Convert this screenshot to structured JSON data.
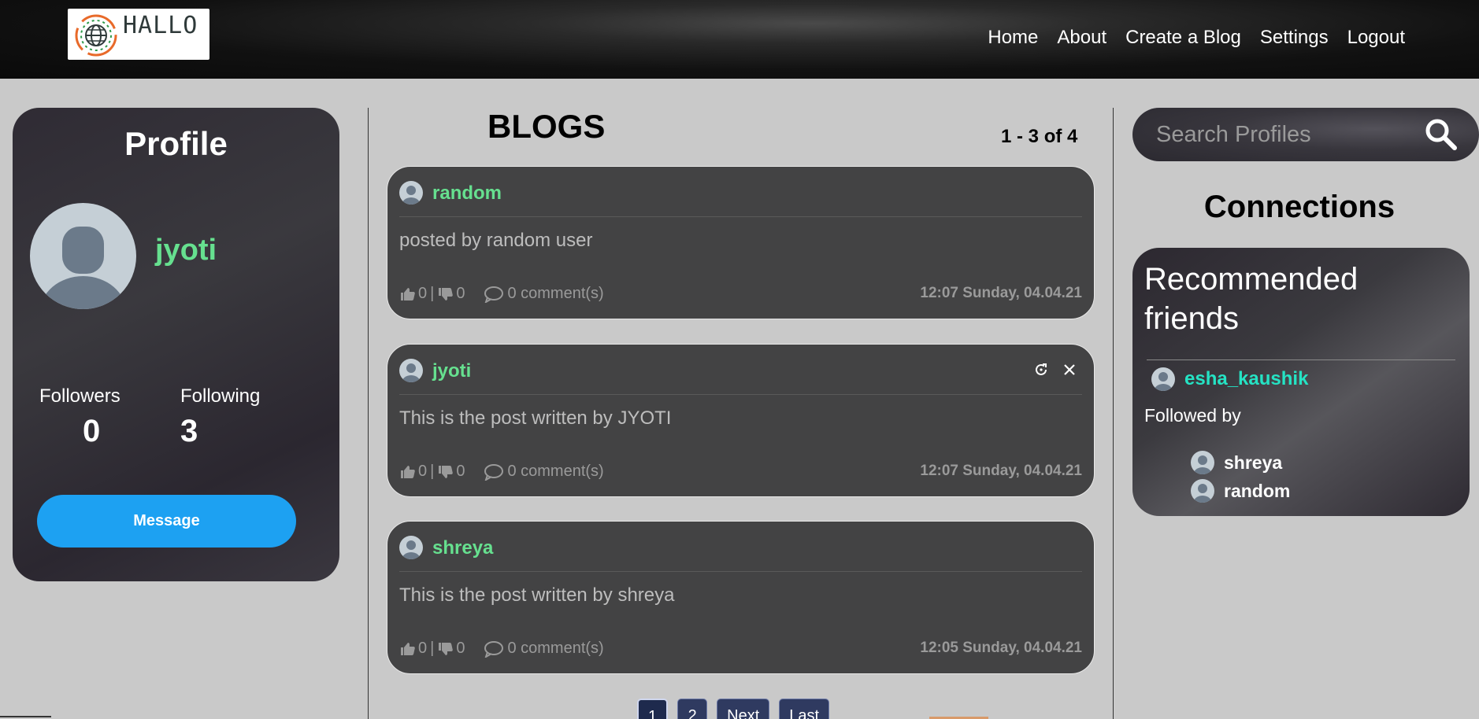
{
  "brand": {
    "logo_text": "HALLO"
  },
  "nav": {
    "items": [
      {
        "label": "Home"
      },
      {
        "label": "About"
      },
      {
        "label": "Create a Blog"
      },
      {
        "label": "Settings"
      },
      {
        "label": "Logout"
      }
    ]
  },
  "profile": {
    "title": "Profile",
    "username": "jyoti",
    "followers_label": "Followers",
    "followers_count": "0",
    "following_label": "Following",
    "following_count": "3",
    "message_button": "Message"
  },
  "blogs": {
    "title": "BLOGS",
    "range": "1 - 3 of 4",
    "posts": [
      {
        "author": "random",
        "body": "posted by random user",
        "likes": "0",
        "dislikes": "0",
        "comments": "0 comment(s)",
        "time": "12:07 Sunday, 04.04.21"
      },
      {
        "author": "jyoti",
        "body": "This is the post written by JYOTI",
        "likes": "0",
        "dislikes": "0",
        "comments": "0 comment(s)",
        "time": "12:07 Sunday, 04.04.21"
      },
      {
        "author": "shreya",
        "body": "This is the post written by shreya",
        "likes": "0",
        "dislikes": "0",
        "comments": "0 comment(s)",
        "time": "12:05 Sunday, 04.04.21"
      }
    ],
    "separator": "|",
    "pagination": [
      {
        "label": "1"
      },
      {
        "label": "2"
      },
      {
        "label": "Next"
      },
      {
        "label": "Last"
      }
    ]
  },
  "search": {
    "placeholder": "Search Profiles"
  },
  "connections": {
    "title": "Connections",
    "recommended_title": "Recommended friends",
    "recommended_user": "esha_kaushik",
    "followed_by_label": "Followed by",
    "followed_by": [
      {
        "name": "shreya"
      },
      {
        "name": "random"
      }
    ]
  },
  "colors": {
    "accent_green": "#66e08f",
    "accent_teal": "#25e3c4",
    "message_blue": "#1da1f2"
  },
  "icons": [
    "globe-logo-icon",
    "avatar-icon",
    "thumbs-up-icon",
    "thumbs-down-icon",
    "comment-icon",
    "refresh-icon",
    "close-icon",
    "search-icon"
  ]
}
